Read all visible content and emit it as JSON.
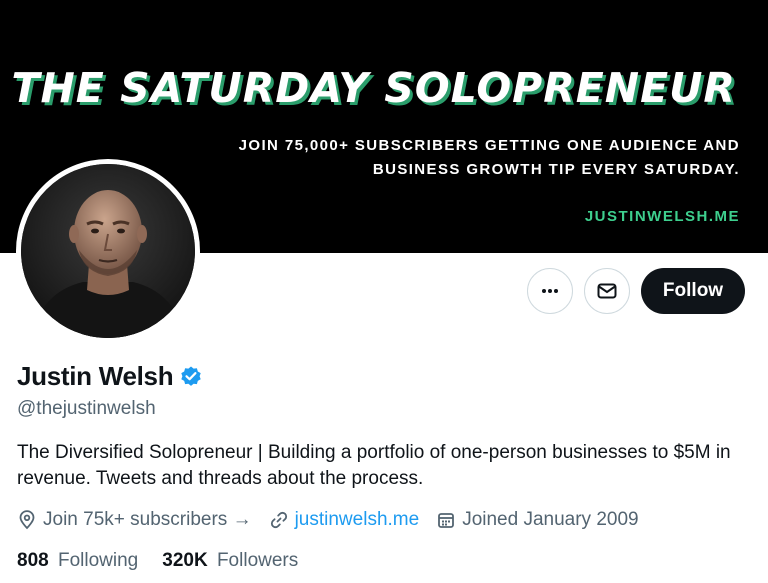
{
  "banner": {
    "title": "THE SATURDAY SOLOPRENEUR",
    "subtitle_line1": "JOIN 75,000+ SUBSCRIBERS GETTING ONE AUDIENCE AND",
    "subtitle_line2": "BUSINESS GROWTH TIP EVERY SATURDAY.",
    "url": "JUSTINWELSH.ME",
    "colors": {
      "background": "#000000",
      "title_shadow": "#2a9d6b",
      "url": "#3ecf8e"
    }
  },
  "actions": {
    "more_icon": "more-horizontal-icon",
    "message_icon": "envelope-icon",
    "follow_label": "Follow"
  },
  "profile": {
    "name": "Justin Welsh",
    "verified_icon": "verified-badge-icon",
    "handle": "@thejustinwelsh",
    "bio": "The Diversified Solopreneur | Building a portfolio of one-person businesses to $5M in revenue. Tweets and threads about the process.",
    "location_icon": "location-pin-icon",
    "location": "Join 75k+ subscribers →",
    "link_icon": "link-icon",
    "website": "justinwelsh.me",
    "calendar_icon": "calendar-icon",
    "joined": "Joined January 2009"
  },
  "stats": {
    "following_count": "808",
    "following_label": "Following",
    "followers_count": "320K",
    "followers_label": "Followers"
  },
  "colors": {
    "accent_link": "#1d9bf0",
    "secondary_text": "#536471",
    "follow_button": "#0f1419"
  }
}
